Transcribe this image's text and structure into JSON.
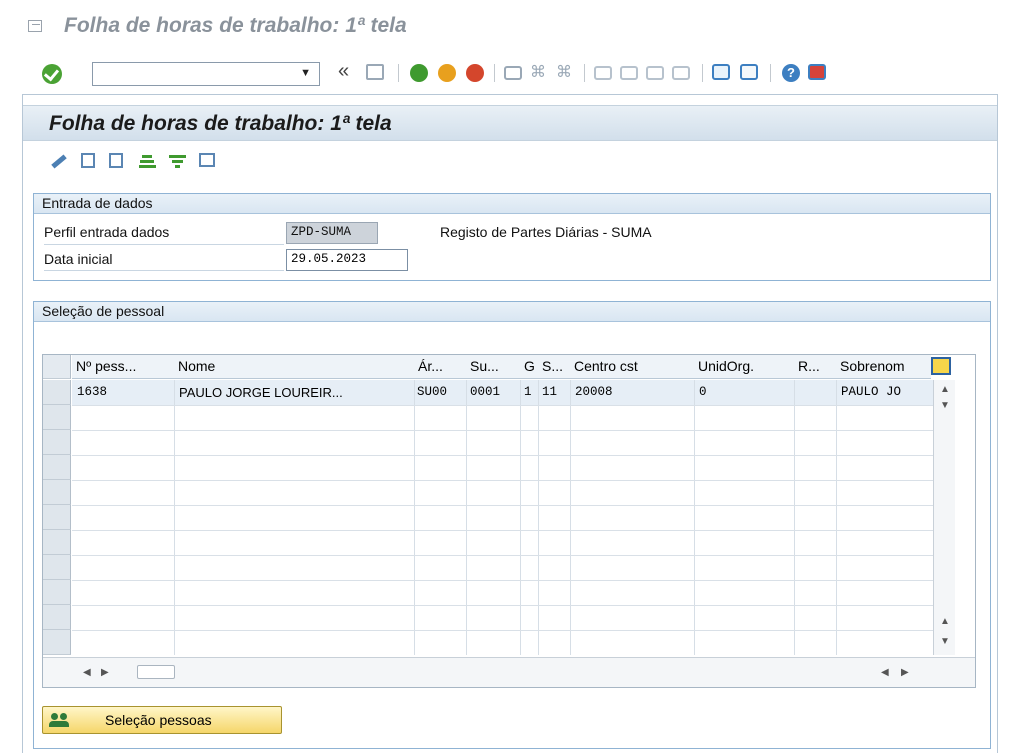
{
  "window": {
    "title": "Folha de horas de trabalho: 1ª tela"
  },
  "toolbar": {
    "command_field_value": "",
    "icons": [
      "enter-check",
      "command-dropdown",
      "collapse-chevron",
      "save",
      "back",
      "exit",
      "cancel",
      "print",
      "find",
      "find-next",
      "first-page",
      "previous-page",
      "next-page",
      "last-page",
      "new-session",
      "shortcut",
      "help",
      "customize-layout"
    ]
  },
  "screen": {
    "title": "Folha de horas de trabalho: 1ª tela"
  },
  "app_toolbar": {
    "icons": [
      "edit-pencil",
      "display",
      "display-details",
      "filter-pyramid",
      "filter",
      "overview"
    ]
  },
  "data_entry": {
    "group_title": "Entrada de dados",
    "profile_label": "Perfil entrada dados",
    "profile_value": "ZPD-SUMA",
    "profile_description": "Registo de Partes Diárias - SUMA",
    "start_date_label": "Data inicial",
    "start_date_value": "29.05.2023"
  },
  "personnel": {
    "group_title": "Seleção de pessoal",
    "columns": [
      "Nº pess...",
      "Nome",
      "Ár...",
      "Su...",
      "G",
      "S...",
      "Centro cst",
      "UnidOrg.",
      "R...",
      "Sobrenom"
    ],
    "rows": [
      {
        "pernr": "1638",
        "name": "PAULO JORGE LOUREIR...",
        "area": "SU00",
        "subarea": "0001",
        "group": "1",
        "subgroup": "11",
        "cost_center": "20008",
        "org_unit": "0",
        "r": "",
        "surname": "PAULO JO"
      }
    ],
    "select_button_label": "Seleção pessoas"
  }
}
